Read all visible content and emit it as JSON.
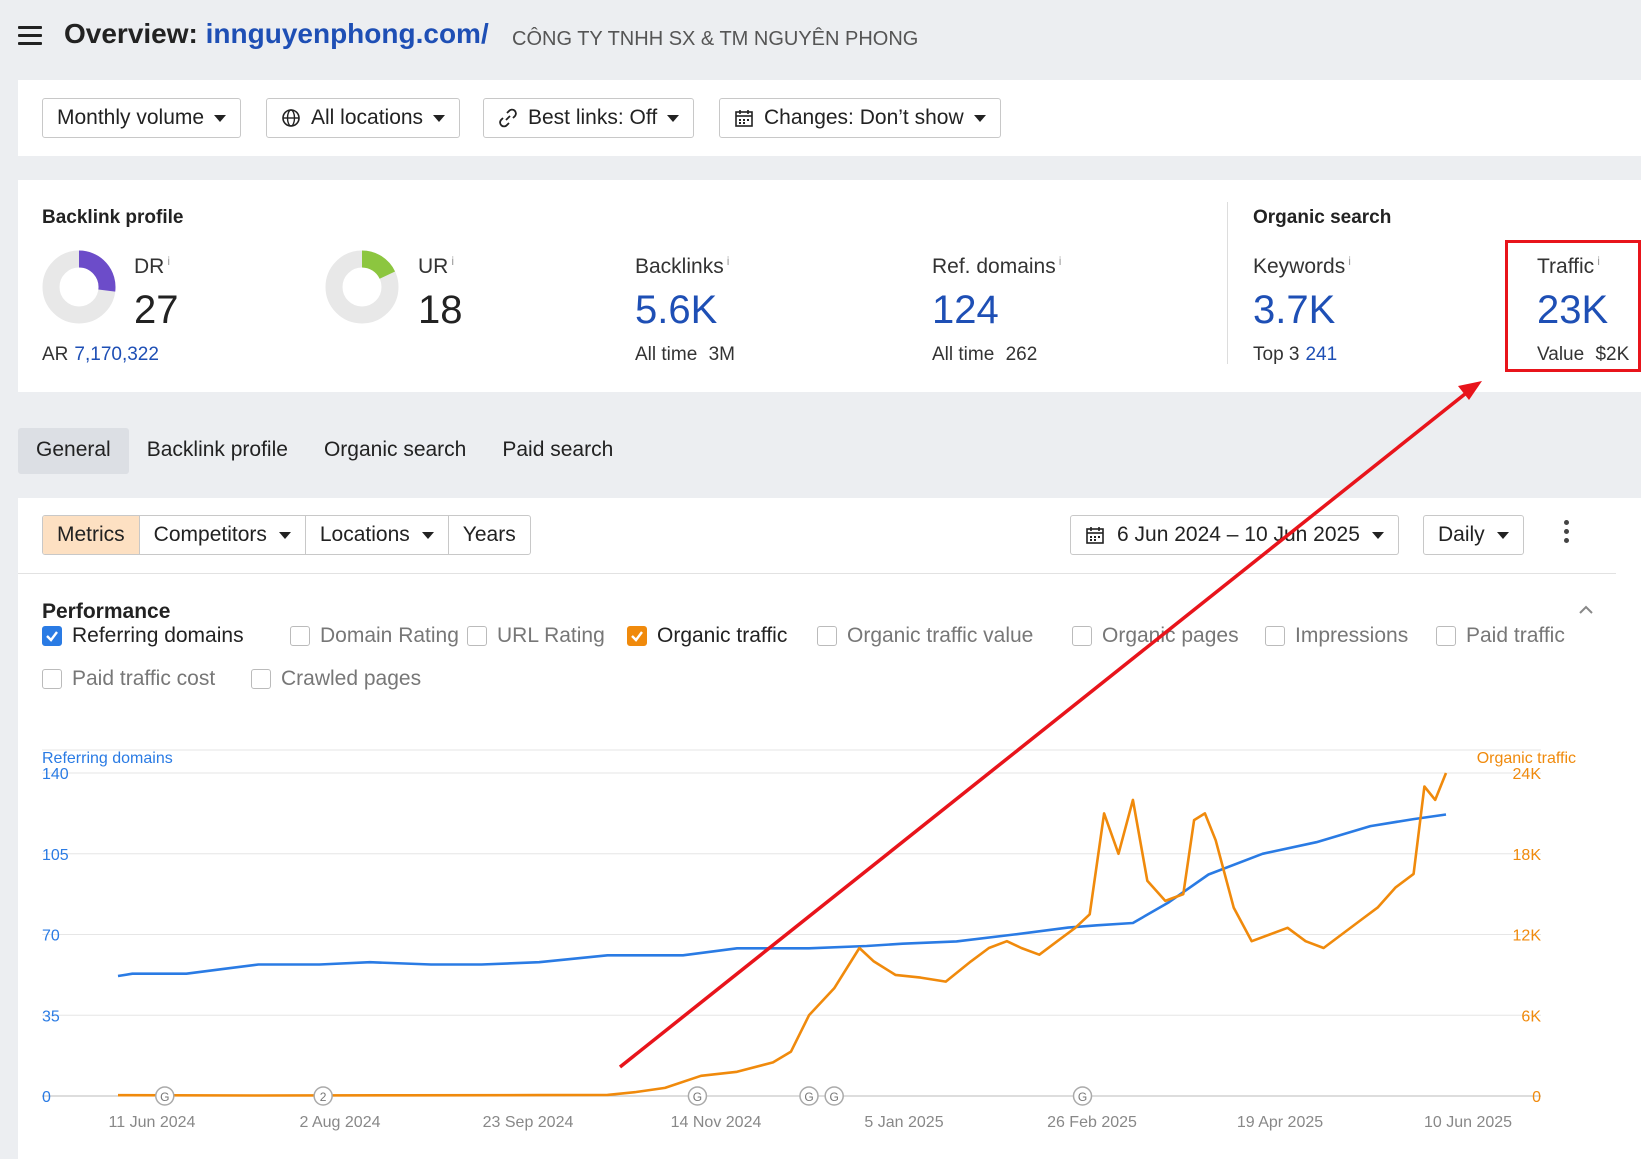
{
  "header": {
    "overview_label": "Overview:",
    "domain": "innguyenphong.com/",
    "company": "CÔNG TY TNHH SX & TM NGUYÊN PHONG"
  },
  "filters": {
    "volume": "Monthly volume",
    "locations": "All locations",
    "best_links": "Best links: Off",
    "changes": "Changes: Don’t show"
  },
  "backlink_profile": {
    "title": "Backlink profile",
    "dr": {
      "label": "DR",
      "value": "27",
      "fill": 0.27,
      "color": "#6c4cc9"
    },
    "ar": {
      "label": "AR",
      "value": "7,170,322"
    },
    "ur": {
      "label": "UR",
      "value": "18",
      "fill": 0.18,
      "color": "#8cc63f"
    },
    "backlinks": {
      "label": "Backlinks",
      "value": "5.6K",
      "sub_label": "All time",
      "sub_value": "3M"
    },
    "ref_domains": {
      "label": "Ref. domains",
      "value": "124",
      "sub_label": "All time",
      "sub_value": "262"
    }
  },
  "organic_search": {
    "title": "Organic search",
    "keywords": {
      "label": "Keywords",
      "value": "3.7K",
      "sub_label": "Top 3",
      "sub_value": "241"
    },
    "traffic": {
      "label": "Traffic",
      "value": "23K",
      "sub_label": "Value",
      "sub_value": "$2K"
    }
  },
  "info_mark": "i",
  "tabs": [
    "General",
    "Backlink profile",
    "Organic search",
    "Paid search"
  ],
  "controls": {
    "segments": [
      "Metrics",
      "Competitors",
      "Locations",
      "Years"
    ],
    "date_range": "6 Jun 2024 – 10 Jun 2025",
    "granularity": "Daily"
  },
  "performance": {
    "title": "Performance",
    "checkboxes": [
      {
        "label": "Referring domains",
        "checked": true,
        "color": "#2a7be4"
      },
      {
        "label": "Domain Rating",
        "checked": false
      },
      {
        "label": "URL Rating",
        "checked": false
      },
      {
        "label": "Organic traffic",
        "checked": true,
        "color": "#f08a0c"
      },
      {
        "label": "Organic traffic value",
        "checked": false
      },
      {
        "label": "Organic pages",
        "checked": false
      },
      {
        "label": "Impressions",
        "checked": false
      },
      {
        "label": "Paid traffic",
        "checked": false
      },
      {
        "label": "Paid traffic cost",
        "checked": false
      },
      {
        "label": "Crawled pages",
        "checked": false
      }
    ]
  },
  "chart_data": {
    "type": "line",
    "y_left_label": "Referring domains",
    "y_right_label": "Organic traffic",
    "y_left_ticks": [
      "140",
      "105",
      "70",
      "35",
      "0"
    ],
    "y_right_ticks": [
      "24K",
      "18K",
      "12K",
      "6K",
      "0"
    ],
    "y_left_range": [
      0,
      140
    ],
    "y_right_range": [
      0,
      24000
    ],
    "x_ticks": [
      "11 Jun 2024",
      "2 Aug 2024",
      "23 Sep 2024",
      "14 Nov 2024",
      "5 Jan 2025",
      "26 Feb 2025",
      "19 Apr 2025",
      "10 Jun 2025"
    ],
    "x_range": [
      "2024-06-06",
      "2025-06-10"
    ],
    "grid": true,
    "annotation_markers": [
      {
        "date": "2024-06-19",
        "label": "G"
      },
      {
        "date": "2024-08-02",
        "label": "2"
      },
      {
        "date": "2024-11-14",
        "label": "G"
      },
      {
        "date": "2024-12-15",
        "label": "G"
      },
      {
        "date": "2024-12-22",
        "label": "G"
      },
      {
        "date": "2025-03-01",
        "label": "G"
      }
    ],
    "series": [
      {
        "name": "Referring domains",
        "axis": "left",
        "color": "#2a7be4",
        "points": [
          [
            "2024-06-06",
            52
          ],
          [
            "2024-06-10",
            53
          ],
          [
            "2024-06-25",
            53
          ],
          [
            "2024-07-05",
            55
          ],
          [
            "2024-07-15",
            57
          ],
          [
            "2024-08-01",
            57
          ],
          [
            "2024-08-15",
            58
          ],
          [
            "2024-09-01",
            57
          ],
          [
            "2024-09-15",
            57
          ],
          [
            "2024-10-01",
            58
          ],
          [
            "2024-10-20",
            61
          ],
          [
            "2024-11-10",
            61
          ],
          [
            "2024-11-25",
            64
          ],
          [
            "2024-12-15",
            64
          ],
          [
            "2024-12-31",
            65
          ],
          [
            "2025-01-10",
            66
          ],
          [
            "2025-01-25",
            67
          ],
          [
            "2025-02-10",
            70
          ],
          [
            "2025-02-25",
            73
          ],
          [
            "2025-03-05",
            74
          ],
          [
            "2025-03-15",
            75
          ],
          [
            "2025-03-25",
            84
          ],
          [
            "2025-04-05",
            96
          ],
          [
            "2025-04-20",
            105
          ],
          [
            "2025-05-05",
            110
          ],
          [
            "2025-05-20",
            117
          ],
          [
            "2025-06-01",
            120
          ],
          [
            "2025-06-10",
            122
          ]
        ]
      },
      {
        "name": "Organic traffic",
        "axis": "right",
        "color": "#f08a0c",
        "points": [
          [
            "2024-06-06",
            60
          ],
          [
            "2024-07-15",
            40
          ],
          [
            "2024-08-25",
            50
          ],
          [
            "2024-10-01",
            70
          ],
          [
            "2024-10-20",
            80
          ],
          [
            "2024-10-28",
            300
          ],
          [
            "2024-11-05",
            600
          ],
          [
            "2024-11-15",
            1500
          ],
          [
            "2024-11-25",
            1800
          ],
          [
            "2024-12-05",
            2500
          ],
          [
            "2024-12-10",
            3300
          ],
          [
            "2024-12-15",
            6000
          ],
          [
            "2024-12-22",
            8000
          ],
          [
            "2024-12-29",
            11000
          ],
          [
            "2025-01-02",
            10000
          ],
          [
            "2025-01-08",
            9000
          ],
          [
            "2025-01-15",
            8800
          ],
          [
            "2025-01-22",
            8500
          ],
          [
            "2025-01-29",
            10000
          ],
          [
            "2025-02-03",
            11000
          ],
          [
            "2025-02-08",
            11500
          ],
          [
            "2025-02-12",
            11000
          ],
          [
            "2025-02-17",
            10500
          ],
          [
            "2025-02-22",
            11500
          ],
          [
            "2025-02-27",
            12500
          ],
          [
            "2025-03-03",
            13500
          ],
          [
            "2025-03-07",
            21000
          ],
          [
            "2025-03-11",
            18000
          ],
          [
            "2025-03-15",
            22000
          ],
          [
            "2025-03-19",
            16000
          ],
          [
            "2025-03-24",
            14500
          ],
          [
            "2025-03-29",
            15000
          ],
          [
            "2025-04-01",
            20500
          ],
          [
            "2025-04-04",
            21000
          ],
          [
            "2025-04-07",
            19000
          ],
          [
            "2025-04-12",
            14000
          ],
          [
            "2025-04-17",
            11500
          ],
          [
            "2025-04-22",
            12000
          ],
          [
            "2025-04-27",
            12500
          ],
          [
            "2025-05-02",
            11500
          ],
          [
            "2025-05-07",
            11000
          ],
          [
            "2025-05-12",
            12000
          ],
          [
            "2025-05-17",
            13000
          ],
          [
            "2025-05-22",
            14000
          ],
          [
            "2025-05-27",
            15500
          ],
          [
            "2025-06-01",
            16500
          ],
          [
            "2025-06-04",
            23000
          ],
          [
            "2025-06-07",
            22000
          ],
          [
            "2025-06-10",
            24000
          ]
        ]
      }
    ]
  }
}
